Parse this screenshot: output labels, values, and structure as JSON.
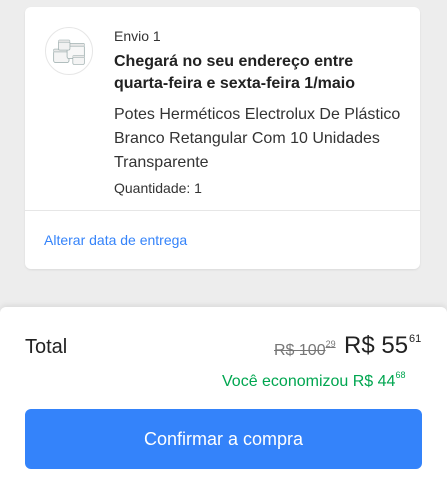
{
  "shipment": {
    "label": "Envio 1",
    "delivery_line1": "Chegará no seu endereço entre",
    "delivery_line2": "quarta-feira e sexta-feira 1/maio",
    "product_title": "Potes Herméticos Electrolux De Plástico Branco Retangular Com 10 Unidades Transparente",
    "quantity": "Quantidade: 1",
    "change_date_link": "Alterar data de entrega"
  },
  "summary": {
    "total_label": "Total",
    "old_price_main": "R$ 100",
    "old_price_cents": "29",
    "new_price_main": "R$ 55",
    "new_price_cents": "61",
    "savings_main": "Você economizou R$ 44",
    "savings_cents": "68",
    "confirm_button": "Confirmar a compra"
  },
  "colors": {
    "accent": "#3483fa",
    "savings_green": "#00a650",
    "background": "#ededed"
  },
  "icons": {
    "product_thumbnail": "food-containers-image"
  }
}
